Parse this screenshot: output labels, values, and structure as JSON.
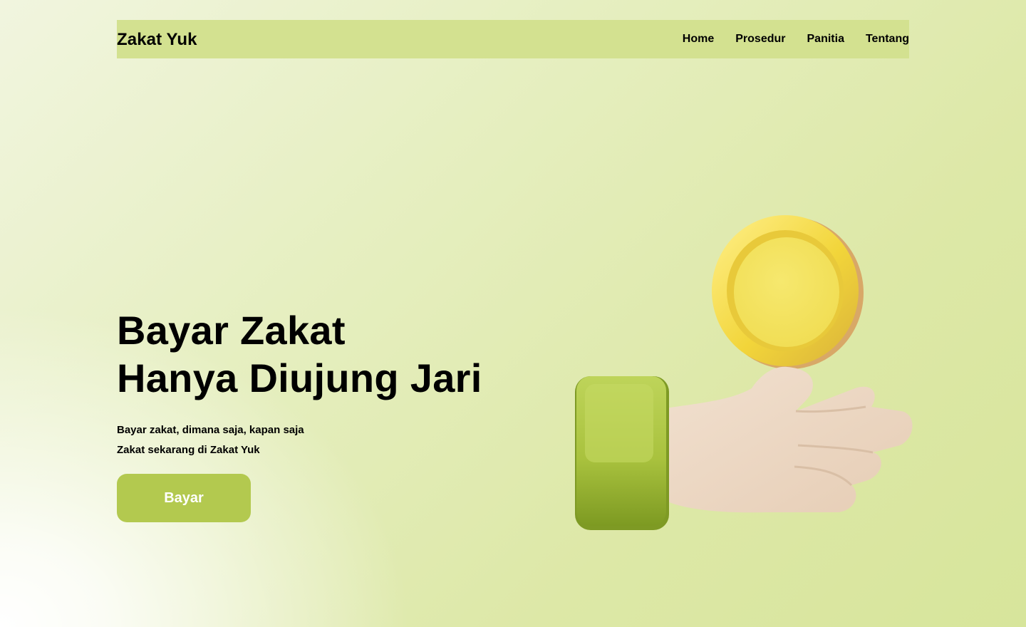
{
  "brand": "Zakat Yuk",
  "nav": {
    "items": [
      "Home",
      "Prosedur",
      "Panitia",
      "Tentang"
    ]
  },
  "hero": {
    "title_line1": "Bayar Zakat",
    "title_line2": "Hanya Diujung Jari",
    "subtitle_line1": "Bayar zakat, dimana saja, kapan saja",
    "subtitle_line2": "Zakat sekarang di Zakat Yuk",
    "cta_label": "Bayar"
  },
  "illustration": {
    "icon": "hand-holding-coin-icon"
  },
  "colors": {
    "navbar": "#d3e190",
    "cta": "#b3c94f",
    "coin": "#f3e35f",
    "sleeve": "#a9c23e",
    "skin": "#ecd7c3"
  }
}
